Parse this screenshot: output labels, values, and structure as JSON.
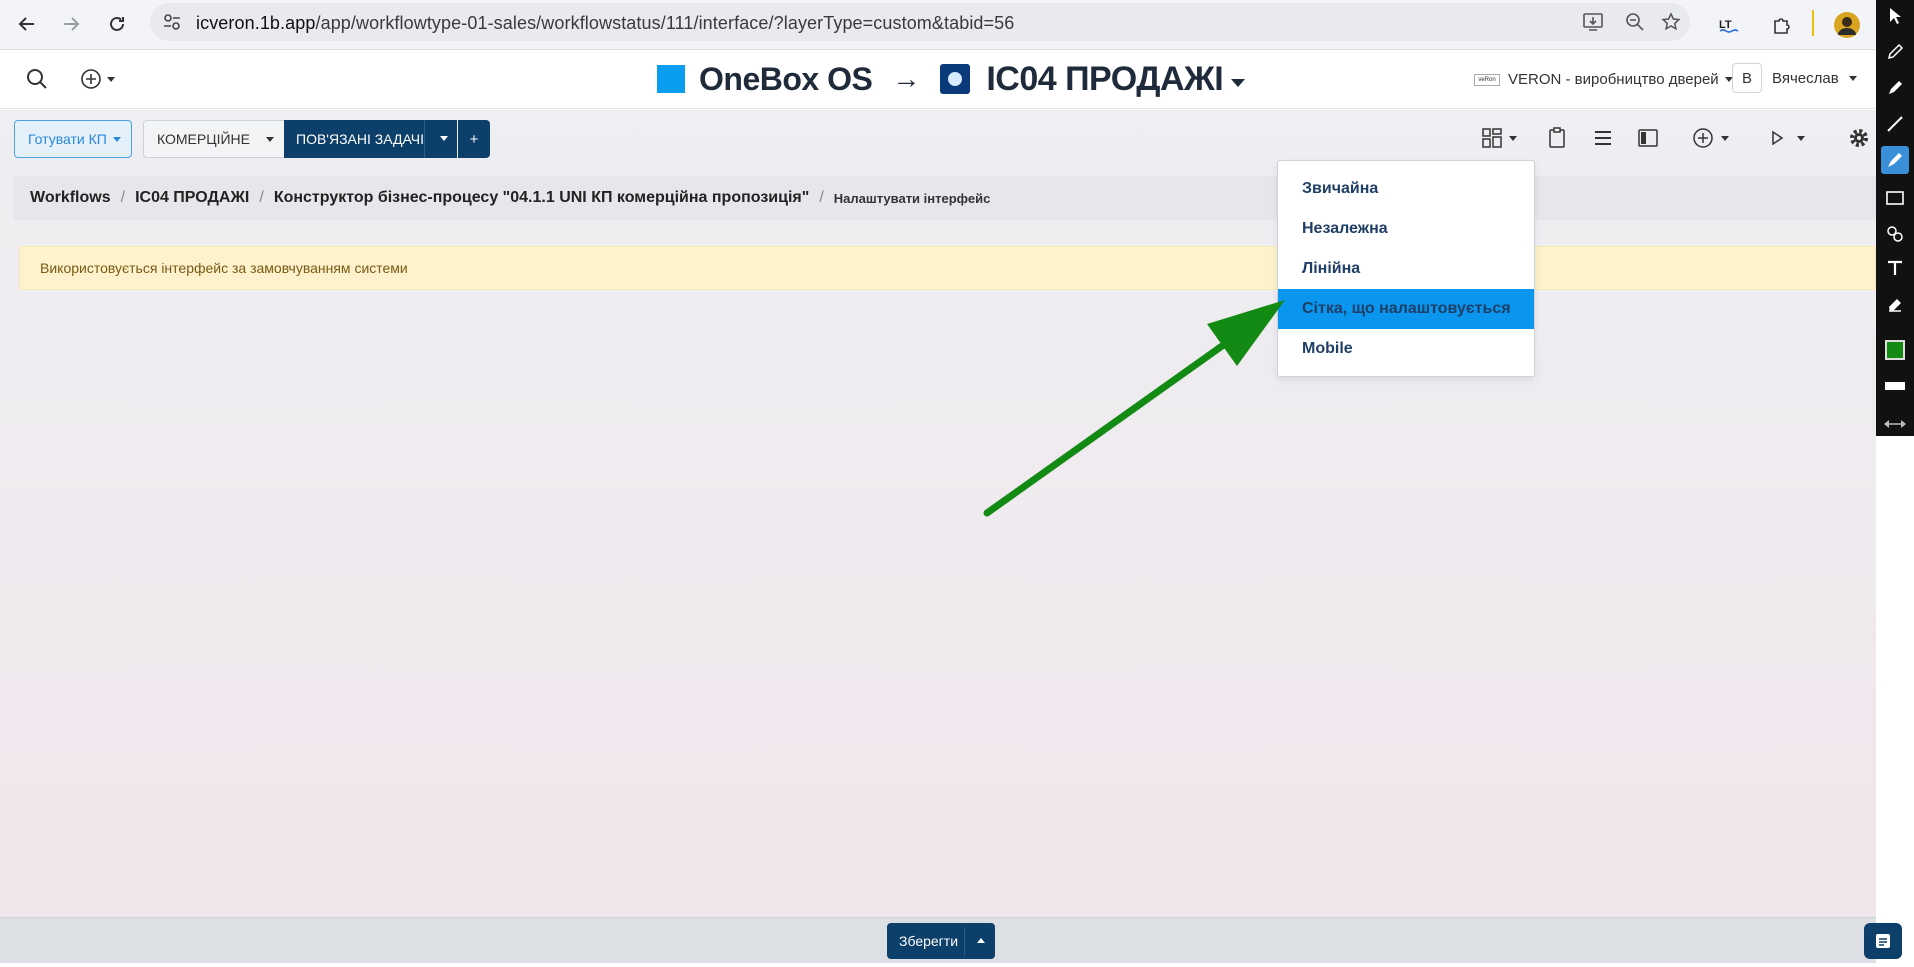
{
  "browser": {
    "url_host": "icveron.1b.app",
    "url_path": "/app/workflowtype-01-sales/workflowstatus/111/interface/?layerType=custom&tabid=56",
    "extensions": [
      "lt-extension-icon",
      "puzzle-icon"
    ]
  },
  "header": {
    "brand": "OneBox OS",
    "arrow": "→",
    "process": "IC04 ПРОДАЖІ",
    "company": "VERON - виробництво дверей",
    "company_logo_text": "vеRon",
    "user_initial": "В",
    "user_name": "Вячеслав"
  },
  "toolbar": {
    "prepare_label": "Готувати КП",
    "commercial_label": "КОМЕРЦІЙНЕ",
    "related_label": "ПОВ'ЯЗАНІ ЗАДАЧІ",
    "plus_label": "+"
  },
  "breadcrumb": {
    "items": [
      "Workflows",
      "IC04 ПРОДАЖІ",
      "Конструктор бізнес-процесу \"04.1.1 UNI КП комерційна пропозиція\""
    ],
    "current": "Налаштувати інтерфейс"
  },
  "alert": {
    "text": "Використовується інтерфейс за замовчуванням системи"
  },
  "dropdown": {
    "items": [
      "Звичайна",
      "Незалежна",
      "Лінійна",
      "Сітка, що налаштовується",
      "Mobile"
    ],
    "selected": "Сітка, що налаштовується"
  },
  "footer": {
    "save_label": "Зберегти"
  },
  "colors": {
    "brand": "#0a9ef0",
    "primary_dark": "#0c3f6a",
    "highlight": "#0a95ef",
    "alert_bg": "#fdf2cc",
    "annotation_arrow": "#138a13"
  },
  "annotation_tools": [
    "cursor-icon",
    "pencil-icon",
    "marker-icon",
    "line-icon",
    "highlighter-icon",
    "rectangle-icon",
    "stamp-icon",
    "text-icon",
    "eraser-icon",
    "color-swatch-icon",
    "stroke-width-icon",
    "collapse-icon"
  ]
}
